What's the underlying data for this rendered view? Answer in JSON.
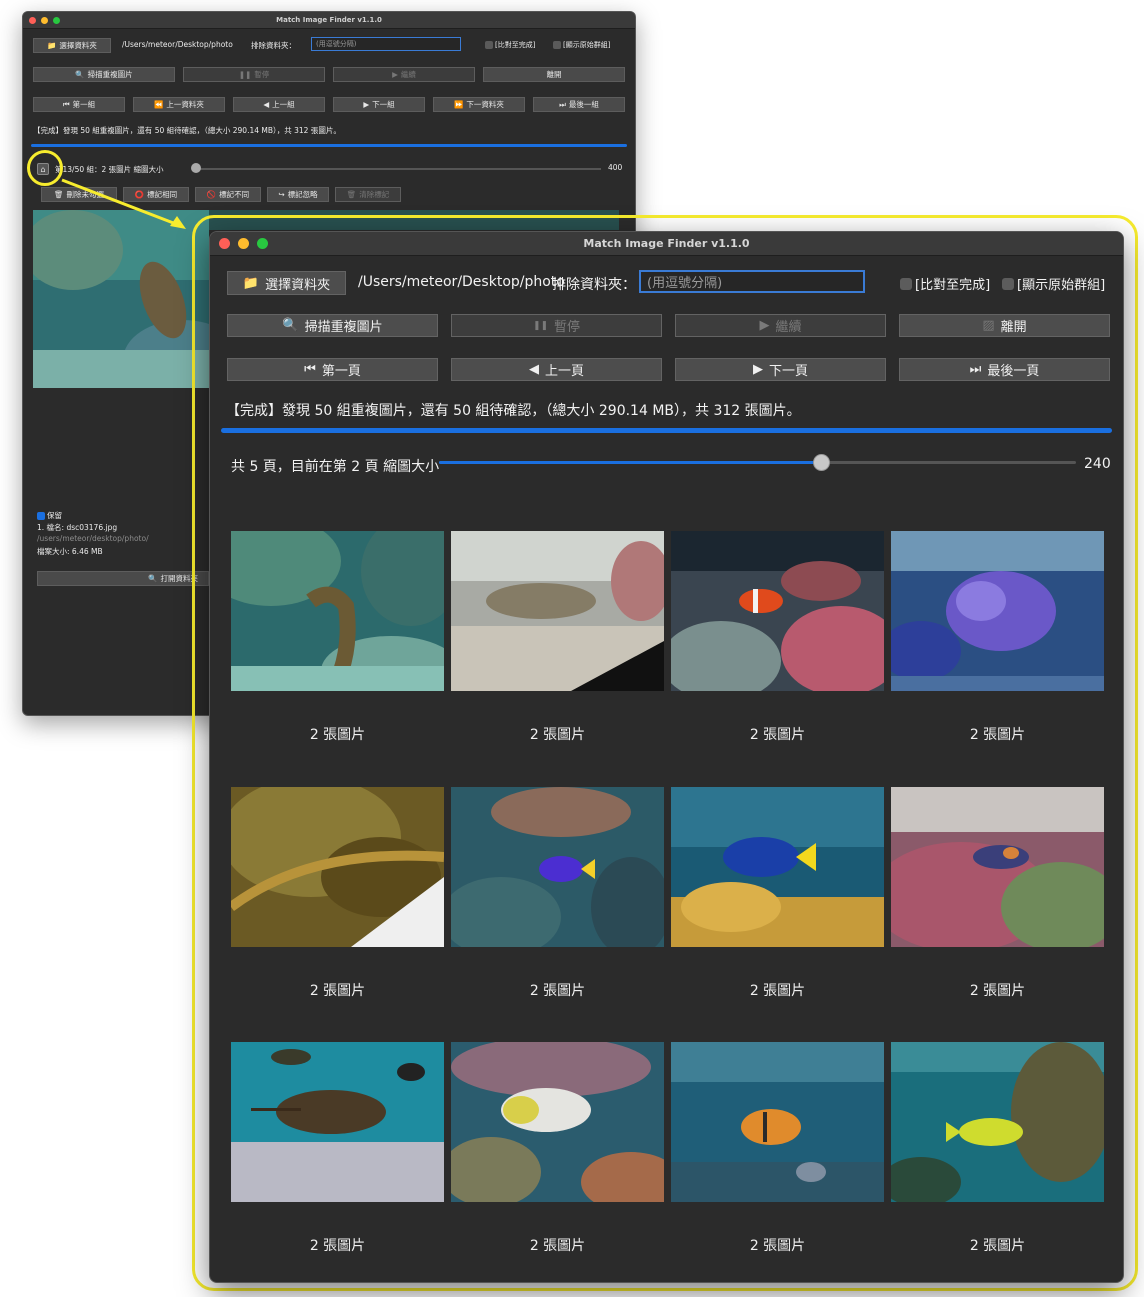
{
  "window": {
    "title": "Match Image Finder v1.1.0"
  },
  "toolbar": {
    "choose_folder": "選擇資料夾",
    "path": "/Users/meteor/Desktop/photo",
    "exclude_label": "排除資料夾：",
    "exclude_placeholder": "(用逗號分隔)",
    "compare_until_done": "[比對至完成]",
    "show_original_groups": "[顯示原始群組]"
  },
  "actions": {
    "scan": "掃描重複圖片",
    "pause": "暫停",
    "resume": "繼續",
    "quit": "離開"
  },
  "back_nav": {
    "first_group": "第一組",
    "prev_folder": "上一資料夾",
    "prev_group": "上一組",
    "next_group": "下一組",
    "next_folder": "下一資料夾",
    "last_group": "最後一組"
  },
  "front_nav": {
    "first_page": "第一頁",
    "prev_page": "上一頁",
    "next_page": "下一頁",
    "last_page": "最後一頁"
  },
  "status": "【完成】發現 50 組重複圖片，還有 50 組待確認，（總大小 290.14 MB），共 312 張圖片。",
  "back_group": {
    "info_a": "第",
    "info_b": "13/50 組：2 張圖片 縮圖大小",
    "slider_value": "400",
    "delete_unchecked": "刪除未勾選",
    "mark_same": "標記相同",
    "mark_different": "標記不同",
    "mark_ignore": "標記忽略",
    "clear_marks": "清除標記",
    "keep": "保留",
    "filename": "1. 檔名: dsc03176.jpg",
    "filepath": "/users/meteor/desktop/photo/",
    "filesize": "檔案大小: 6.46 MB",
    "open_folder": "打開資料夾"
  },
  "page_info": {
    "label": "共 5 頁，目前在第 2 頁 縮圖大小",
    "slider_value": "240",
    "slider_fraction": 0.6
  },
  "grid": [
    {
      "caption": "2 張圖片"
    },
    {
      "caption": "2 張圖片"
    },
    {
      "caption": "2 張圖片"
    },
    {
      "caption": "2 張圖片"
    },
    {
      "caption": "2 張圖片"
    },
    {
      "caption": "2 張圖片"
    },
    {
      "caption": "2 張圖片"
    },
    {
      "caption": "2 張圖片"
    },
    {
      "caption": "2 張圖片"
    },
    {
      "caption": "2 張圖片"
    },
    {
      "caption": "2 張圖片"
    },
    {
      "caption": "2 張圖片"
    }
  ],
  "colors": {
    "accent": "#1a6fe0",
    "highlight": "#f7ec2e",
    "window_bg": "#2b2b2b"
  }
}
